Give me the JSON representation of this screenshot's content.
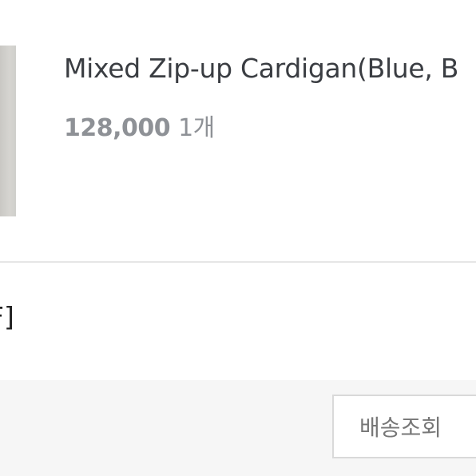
{
  "product": {
    "name": "Mixed Zip-up Cardigan(Blue, B",
    "price": "128,000",
    "quantity": "1개"
  },
  "order": {
    "option_text": "F]"
  },
  "actions": {
    "track_delivery_label": "배송조회"
  },
  "colors": {
    "background": "#ffffff",
    "footer_bg": "#f6f6f6",
    "product_name": "#3a3d42",
    "price_text": "#8e9196",
    "divider": "#e6e6e6",
    "button_border": "#d9d9d9"
  }
}
